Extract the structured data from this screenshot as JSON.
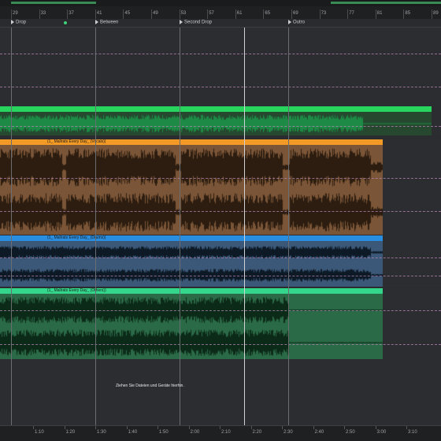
{
  "ruler": {
    "bars": [
      "29",
      "33",
      "37",
      "41",
      "45",
      "49",
      "53",
      "57",
      "61",
      "65",
      "69",
      "73",
      "77",
      "81",
      "85",
      "89"
    ]
  },
  "markers": [
    {
      "label": "Drop"
    },
    {
      "label": "Between"
    },
    {
      "label": "Second Drop"
    },
    {
      "label": "Outro"
    }
  ],
  "tracks": [
    {
      "name": "",
      "color": "#26d45e",
      "wave_color": "#1d8a45"
    },
    {
      "name": "(1_ Mallrats Every Day_ (Vocals))",
      "color": "#f29a25",
      "wave_color": "#2c1d10"
    },
    {
      "name": "(1_ Mallrats Every Day_ (Drums))",
      "color": "#2a8ee0",
      "wave_color": "#0d1a26"
    },
    {
      "name": "(1_ Mallrats Every Day_ (Others))",
      "color": "#33d68b",
      "wave_color": "#0c2a18"
    }
  ],
  "drop_hint": "Ziehen Sie Dateien und Geräte hierhin.",
  "time_ruler": {
    "labels": [
      "1:10",
      "1:20",
      "1:30",
      "1:40",
      "1:50",
      "2:00",
      "2:10",
      "2:20",
      "2:30",
      "2:40",
      "2:50",
      "3:00",
      "3:10"
    ]
  },
  "colors": {
    "background": "#2b2c2f",
    "grid_line": "#6a6d72",
    "dashed_line": "#b486b4"
  }
}
